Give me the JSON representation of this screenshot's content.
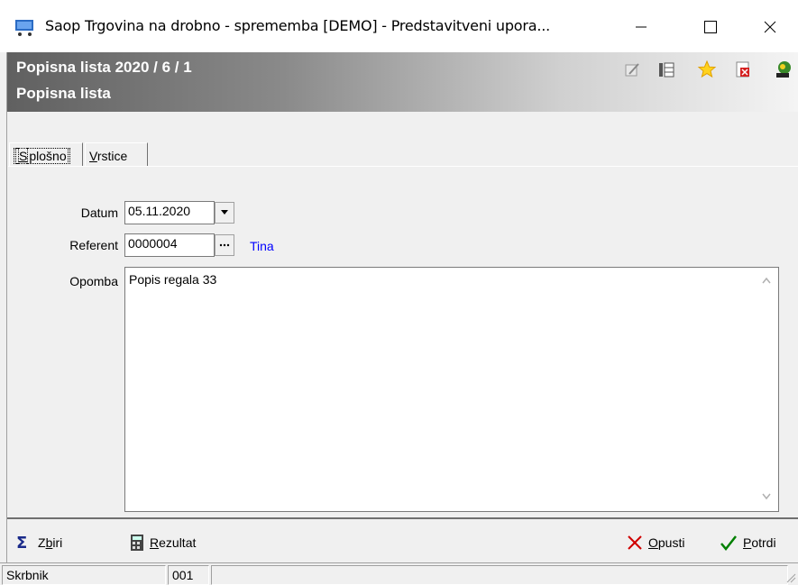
{
  "window": {
    "title": "Saop Trgovina na drobno - sprememba [DEMO] - Predstavitveni upora...",
    "icon": "shopping-cart-icon"
  },
  "header": {
    "title": "Popisna lista 2020 / 6 / 1",
    "subtitle": "Popisna lista",
    "icons": [
      "edit-icon",
      "columns-icon",
      "star-icon",
      "delete-doc-icon",
      "person-help-icon"
    ]
  },
  "tabs": [
    {
      "label_pre": "",
      "label_u": "S",
      "label_post": "plošno",
      "active": true
    },
    {
      "label_pre": "",
      "label_u": "V",
      "label_post": "rstice",
      "active": false
    }
  ],
  "form": {
    "datum_label": "Datum",
    "datum_value": "05.11.2020",
    "referent_label": "Referent",
    "referent_value": "0000004",
    "referent_name": "Tina",
    "opomba_label": "Opomba",
    "opomba_value": "Popis regala 33"
  },
  "footer": {
    "zbiri_pre": "Z",
    "zbiri_u": "b",
    "zbiri_post": "iri",
    "rezultat_pre": "",
    "rezultat_u": "R",
    "rezultat_post": "ezultat",
    "opusti_pre": "",
    "opusti_u": "O",
    "opusti_post": "pusti",
    "potrdi_pre": "",
    "potrdi_u": "P",
    "potrdi_post": "otrdi"
  },
  "status": {
    "panel1": "Skrbnik",
    "panel2": "001",
    "panel3": ""
  },
  "colors": {
    "link": "#0000ff",
    "cancel": "#d00000",
    "confirm": "#008000"
  }
}
